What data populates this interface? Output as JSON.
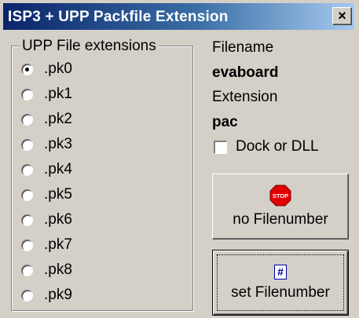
{
  "window": {
    "title": "ISP3 + UPP Packfile Extension",
    "close_label": "×"
  },
  "extensions_group": {
    "label": "UPP File extensions",
    "selected": ".pk0",
    "options": [
      {
        "label": ".pk0",
        "checked": true
      },
      {
        "label": ".pk1",
        "checked": false
      },
      {
        "label": ".pk2",
        "checked": false
      },
      {
        "label": ".pk3",
        "checked": false
      },
      {
        "label": ".pk4",
        "checked": false
      },
      {
        "label": ".pk5",
        "checked": false
      },
      {
        "label": ".pk6",
        "checked": false
      },
      {
        "label": ".pk7",
        "checked": false
      },
      {
        "label": ".pk8",
        "checked": false
      },
      {
        "label": ".pk9",
        "checked": false
      }
    ]
  },
  "info": {
    "filename_label": "Filename",
    "filename_value": "evaboard",
    "extension_label": "Extension",
    "extension_value": "pac"
  },
  "dock_checkbox": {
    "label": "Dock or DLL",
    "checked": false
  },
  "buttons": {
    "no_filenumber": {
      "label": "no Filenumber",
      "icon": "stop-icon",
      "icon_text": "STOP",
      "icon_color": "#e00000"
    },
    "set_filenumber": {
      "label": "set Filenumber",
      "icon": "hash-icon",
      "icon_text": "#",
      "icon_color": "#0000a0"
    }
  }
}
